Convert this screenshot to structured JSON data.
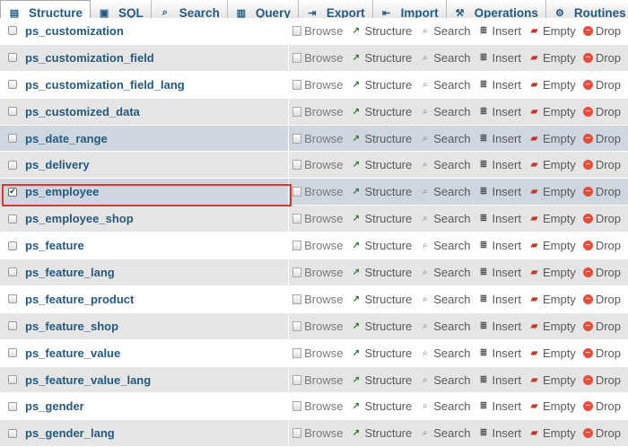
{
  "tabs": [
    {
      "label": "Structure",
      "icon": "structure-icon",
      "active": true
    },
    {
      "label": "SQL",
      "icon": "sql-icon"
    },
    {
      "label": "Search",
      "icon": "search-icon"
    },
    {
      "label": "Query",
      "icon": "query-icon"
    },
    {
      "label": "Export",
      "icon": "export-icon"
    },
    {
      "label": "Import",
      "icon": "import-icon"
    },
    {
      "label": "Operations",
      "icon": "wrench-icon"
    },
    {
      "label": "Routines",
      "icon": "routines-icon"
    }
  ],
  "actions": {
    "browse": "Browse",
    "structure": "Structure",
    "search": "Search",
    "insert": "Insert",
    "empty": "Empty",
    "drop": "Drop"
  },
  "tables": [
    {
      "name": "ps_customization",
      "checked": false
    },
    {
      "name": "ps_customization_field",
      "checked": false
    },
    {
      "name": "ps_customization_field_lang",
      "checked": false
    },
    {
      "name": "ps_customized_data",
      "checked": false
    },
    {
      "name": "ps_date_range",
      "checked": false,
      "hover": true
    },
    {
      "name": "ps_delivery",
      "checked": false
    },
    {
      "name": "ps_employee",
      "checked": true,
      "highlighted": true
    },
    {
      "name": "ps_employee_shop",
      "checked": false
    },
    {
      "name": "ps_feature",
      "checked": false
    },
    {
      "name": "ps_feature_lang",
      "checked": false
    },
    {
      "name": "ps_feature_product",
      "checked": false
    },
    {
      "name": "ps_feature_shop",
      "checked": false
    },
    {
      "name": "ps_feature_value",
      "checked": false
    },
    {
      "name": "ps_feature_value_lang",
      "checked": false
    },
    {
      "name": "ps_gender",
      "checked": false
    },
    {
      "name": "ps_gender_lang",
      "checked": false
    }
  ],
  "colors": {
    "link": "#235a81",
    "highlight_border": "#d83a2e",
    "row_even": "#e5e5e5",
    "row_hover": "#ced6df"
  }
}
